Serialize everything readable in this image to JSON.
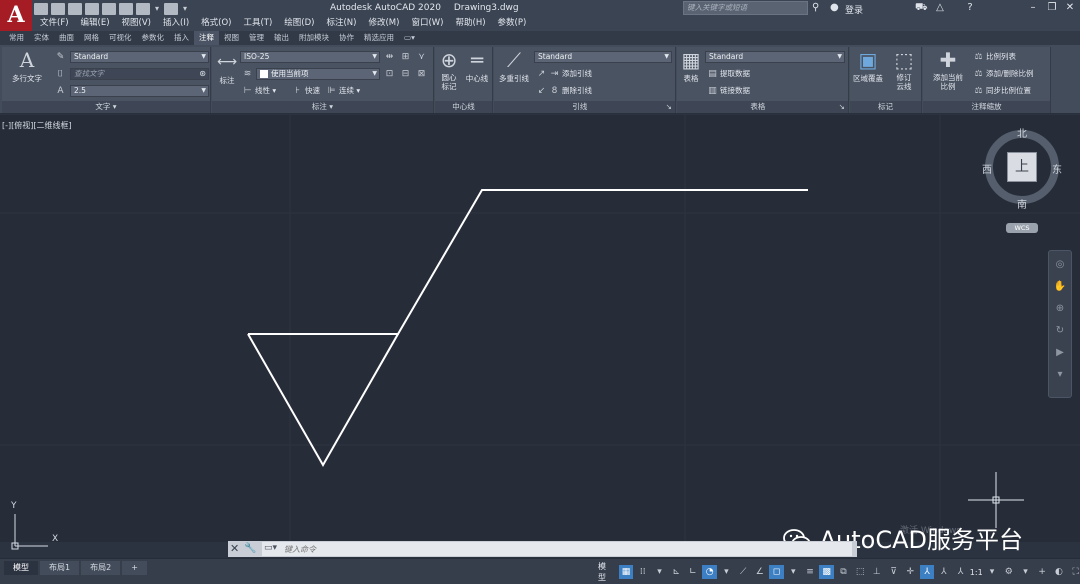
{
  "app": {
    "logo": "A",
    "title": "Autodesk AutoCAD 2020",
    "document": "Drawing3.dwg",
    "search_placeholder": "键入关键字或短语",
    "login": "登录"
  },
  "menu": [
    "文件(F)",
    "编辑(E)",
    "视图(V)",
    "插入(I)",
    "格式(O)",
    "工具(T)",
    "绘图(D)",
    "标注(N)",
    "修改(M)",
    "窗口(W)",
    "帮助(H)",
    "参数(P)"
  ],
  "ribbon_tabs": [
    "常用",
    "实体",
    "曲面",
    "网格",
    "可视化",
    "参数化",
    "插入",
    "注释",
    "视图",
    "管理",
    "输出",
    "附加模块",
    "协作",
    "精选应用"
  ],
  "active_tab": "注释",
  "ribbon": {
    "text_panel": {
      "label": "文字",
      "multiline_text": "多行文字",
      "text_style": "Standard",
      "find_text": "查找文字",
      "text_height": "2.5"
    },
    "dimension_panel": {
      "label": "标注",
      "dimension_btn": "标注",
      "dim_style": "ISO-25",
      "layer": "使用当前项",
      "linear": "线性",
      "quick": "快速",
      "continue": "连续"
    },
    "centerline_panel": {
      "label": "中心线",
      "center_mark": "圆心标记",
      "centerline": "中心线"
    },
    "leader_panel": {
      "label": "引线",
      "multileader": "多重引线",
      "leader_style": "Standard",
      "add_leader": "添加引线",
      "remove_leader": "删除引线"
    },
    "table_panel": {
      "label": "表格",
      "table": "表格",
      "table_style": "Standard",
      "extract_data": "提取数据",
      "link_data": "链接数据"
    },
    "markup_panel": {
      "label": "标记",
      "wipeout": "区域覆盖",
      "revcloud": "修订云线"
    },
    "scale_panel": {
      "label": "注释缩放",
      "add_current_scale": "添加当前比例",
      "scale_list": "比例列表",
      "add_delete_scale": "添加/删除比例",
      "sync_scale_pos": "同步比例位置"
    }
  },
  "viewport": {
    "label": "[-][俯视][二维线框]"
  },
  "viewcube": {
    "north": "北",
    "south": "南",
    "east": "东",
    "west": "西",
    "top_face": "上",
    "wcs": "WCS"
  },
  "ucs": {
    "x": "X",
    "y": "Y"
  },
  "watermark": {
    "text": "AutoCAD服务平台",
    "activate": "激活 Windows"
  },
  "command": {
    "placeholder": "键入命令"
  },
  "layout_tabs": [
    "模型",
    "布局1",
    "布局2"
  ],
  "status": {
    "model": "模型",
    "scale": "1:1"
  },
  "colors": {
    "canvas": "#262c38",
    "line": "#ffffff",
    "accent": "#3c7fc3",
    "logo": "#a61c24"
  }
}
